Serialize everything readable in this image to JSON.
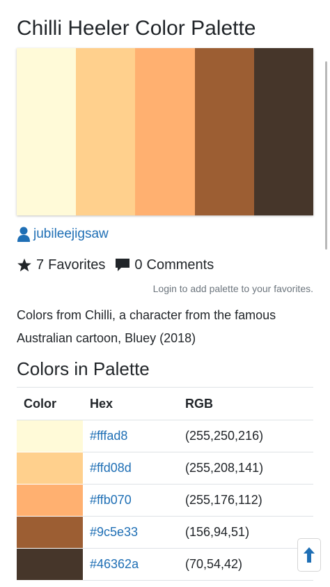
{
  "page": {
    "title": "Chilli Heeler Color Palette"
  },
  "palette": {
    "colors": [
      "#fffad8",
      "#ffd08d",
      "#ffb070",
      "#9c5e33",
      "#46362a"
    ]
  },
  "author": {
    "username": "jubileejigsaw",
    "icon": "user-icon"
  },
  "stats": {
    "favorites_count": "7",
    "favorites_label": "Favorites",
    "favorites_icon": "star-icon",
    "comments_count": "0",
    "comments_label": "Comments",
    "comments_icon": "comment-icon"
  },
  "login_note": "Login to add palette to your favorites.",
  "description": "Colors from Chilli, a character from the famous Australian cartoon, Bluey (2018)",
  "colors_section": {
    "title": "Colors in Palette",
    "headers": {
      "color": "Color",
      "hex": "Hex",
      "rgb": "RGB"
    },
    "rows": [
      {
        "swatch": "#fffad8",
        "hex": "#fffad8",
        "rgb": "(255,250,216)"
      },
      {
        "swatch": "#ffd08d",
        "hex": "#ffd08d",
        "rgb": "(255,208,141)"
      },
      {
        "swatch": "#ffb070",
        "hex": "#ffb070",
        "rgb": "(255,176,112)"
      },
      {
        "swatch": "#9c5e33",
        "hex": "#9c5e33",
        "rgb": "(156,94,51)"
      },
      {
        "swatch": "#46362a",
        "hex": "#46362a",
        "rgb": "(70,54,42)"
      }
    ]
  },
  "scroll_top": {
    "icon": "arrow-up-icon",
    "color": "#1f6fb5"
  },
  "colors": {
    "link": "#1f6fb5",
    "text": "#212529",
    "muted": "#6c757d"
  }
}
